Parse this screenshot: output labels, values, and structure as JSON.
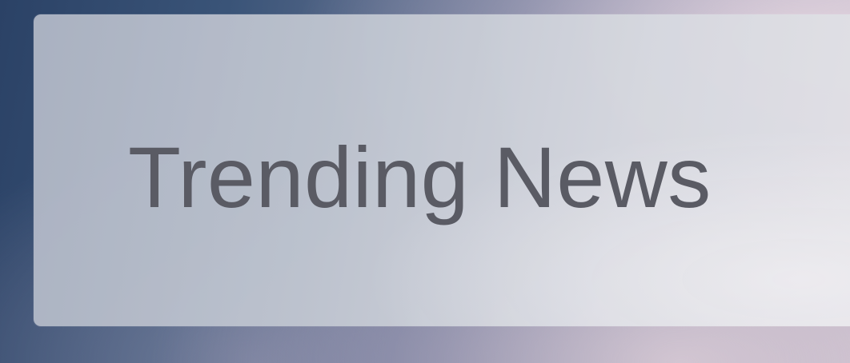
{
  "card": {
    "title": "Trending News"
  },
  "colors": {
    "title_text": "#5a5b64",
    "card_background": "#c4c8d2",
    "background_dark": "#2b4266",
    "background_light": "#cfc4cf"
  }
}
